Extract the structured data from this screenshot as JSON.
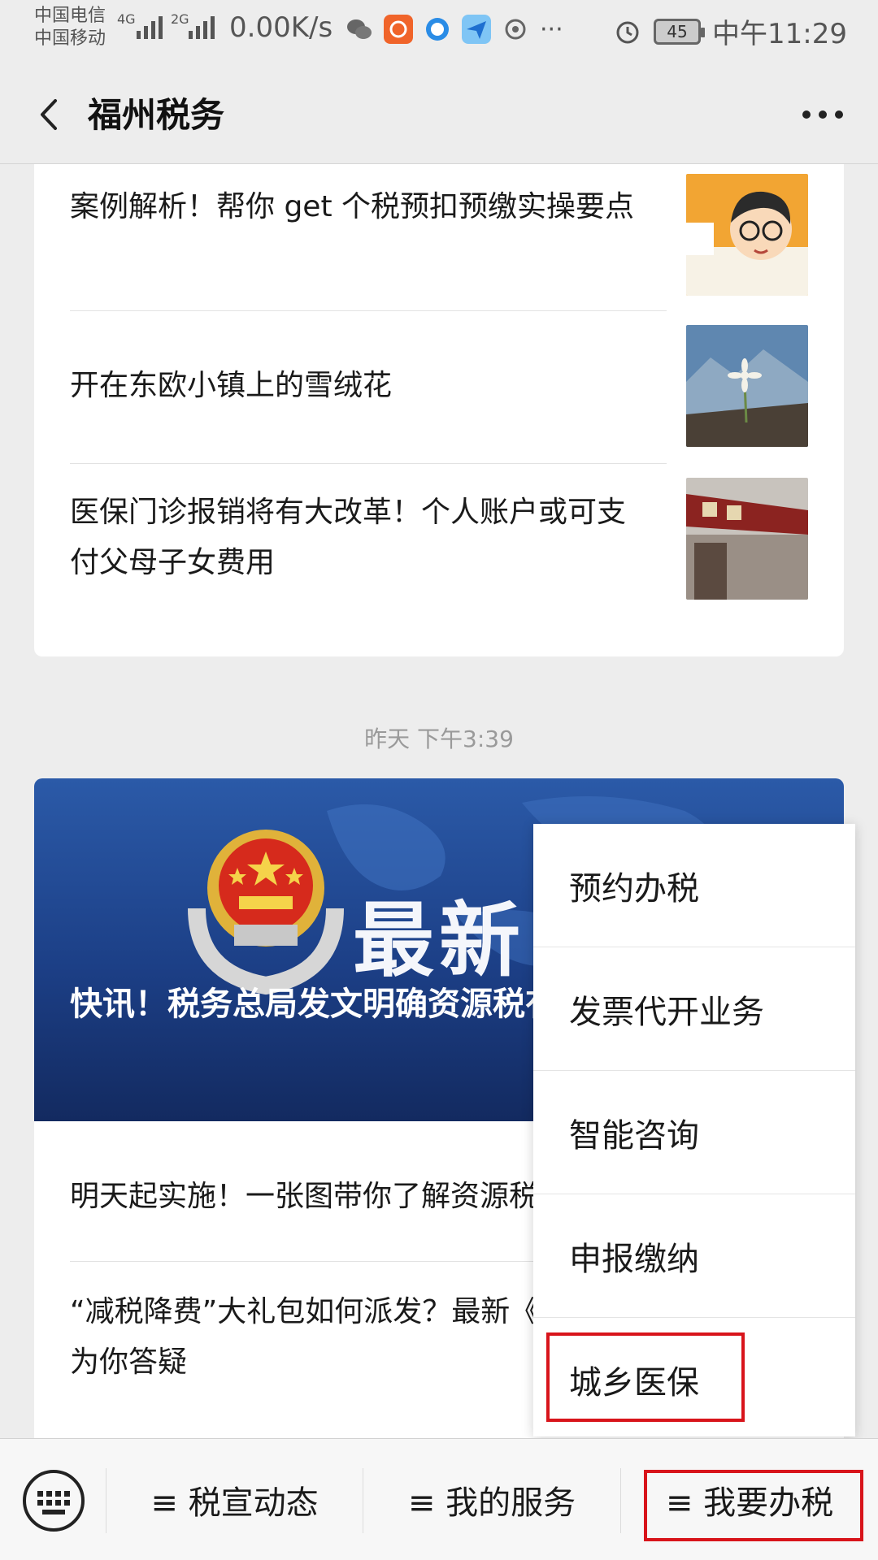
{
  "status_bar": {
    "carrier1": "中国电信",
    "carrier2": "中国移动",
    "net1": "4G",
    "net2": "2G",
    "speed": "0.00K/s",
    "overflow": "···",
    "battery": "45",
    "time": "中午11:29"
  },
  "header": {
    "title": "福州税务"
  },
  "articles_top": [
    {
      "title": "案例解析！帮你 get 个税预扣预缴实操要点"
    },
    {
      "title": "开在东欧小镇上的雪绒花"
    },
    {
      "title": "医保门诊报销将有大改革！个人账户或可支付父母子女费用"
    }
  ],
  "timestamp": "昨天 下午3:39",
  "feature": {
    "title": "快讯！税务总局发文明确资源税有关问题",
    "hero_text": "最新"
  },
  "articles_bottom": [
    {
      "title": "明天起实施！一张图带你了解资源税"
    },
    {
      "title": "“减税降费”大礼包如何派发？最新《中国福建·在线访谈》为你答疑"
    }
  ],
  "menu": {
    "items": [
      {
        "label": "预约办税"
      },
      {
        "label": "发票代开业务"
      },
      {
        "label": "智能咨询"
      },
      {
        "label": "申报缴纳"
      },
      {
        "label": "城乡医保"
      }
    ],
    "highlighted": "城乡医保"
  },
  "bottom_bar": {
    "tabs": [
      {
        "label": "≡ 税宣动态"
      },
      {
        "label": "≡ 我的服务"
      },
      {
        "label": "≡ 我要办税"
      }
    ],
    "highlighted": "≡ 我要办税"
  },
  "colors": {
    "highlight_border": "#d8141b",
    "background": "#ededed"
  }
}
